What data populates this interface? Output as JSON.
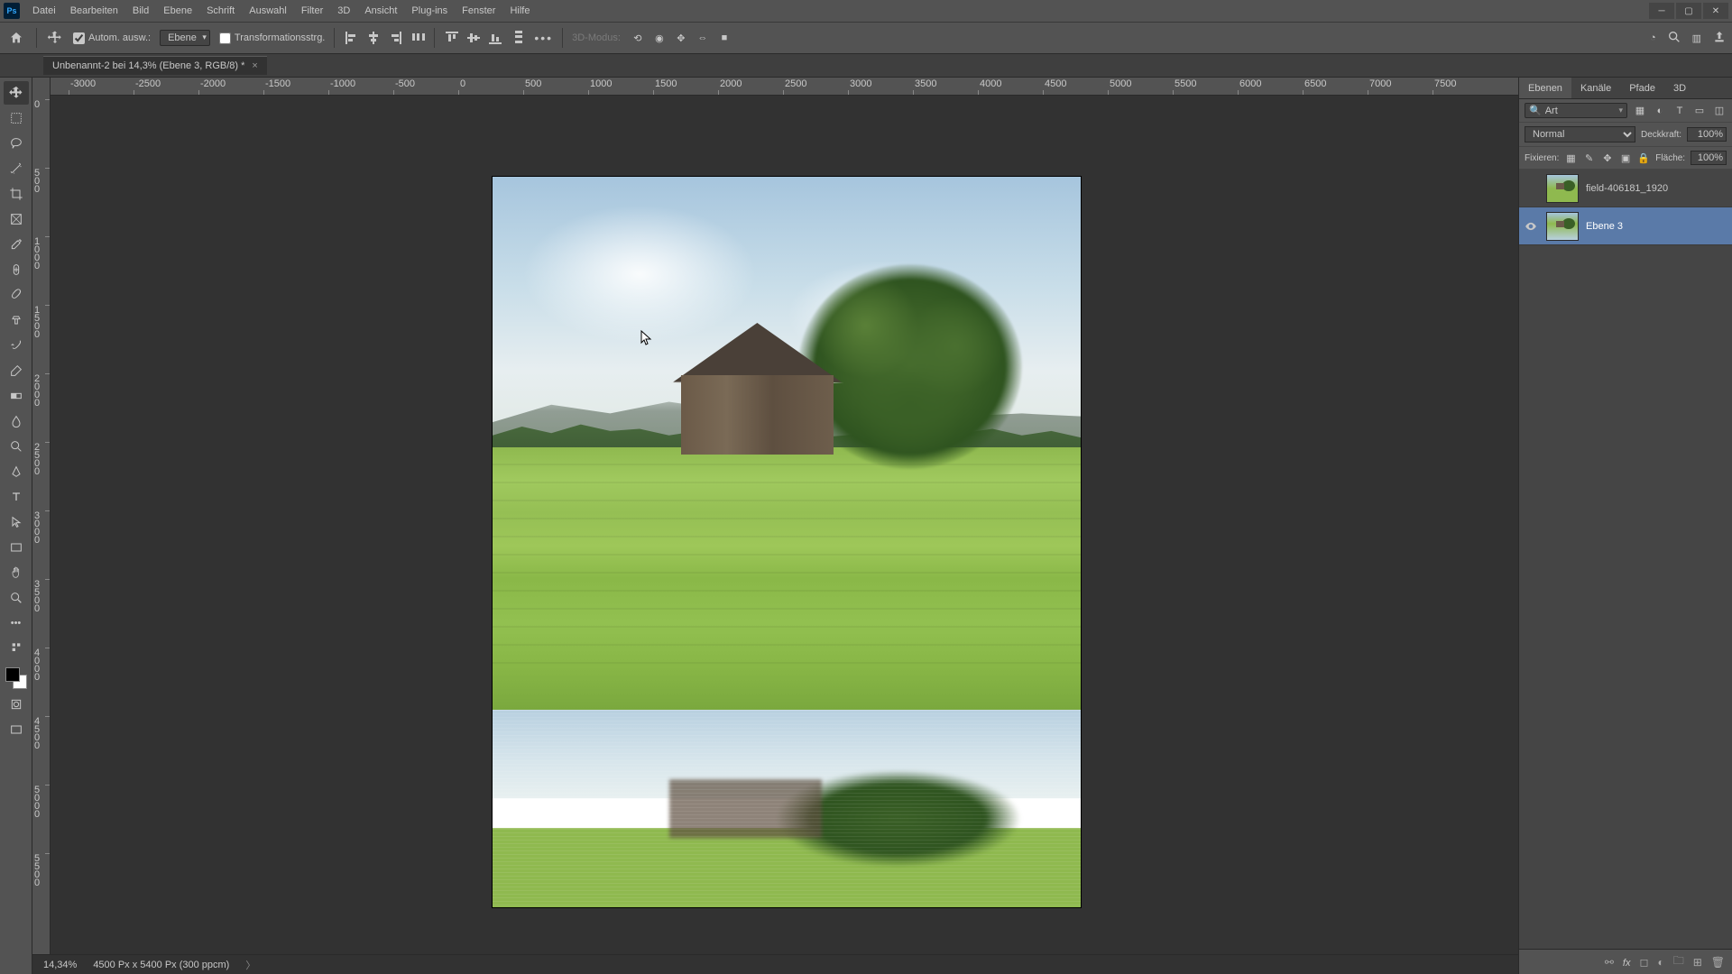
{
  "menubar": {
    "logo": "Ps",
    "items": [
      "Datei",
      "Bearbeiten",
      "Bild",
      "Ebene",
      "Schrift",
      "Auswahl",
      "Filter",
      "3D",
      "Ansicht",
      "Plug-ins",
      "Fenster",
      "Hilfe"
    ]
  },
  "optionsbar": {
    "auto_select_label": "Autom. ausw.:",
    "auto_select_target": "Ebene",
    "transform_controls_label": "Transformationsstrg.",
    "mode_3d_label": "3D-Modus:"
  },
  "document": {
    "tab_title": "Unbenannt-2 bei 14,3% (Ebene 3, RGB/8) *"
  },
  "ruler_h": [
    "-3000",
    "-2500",
    "-2000",
    "-1500",
    "-1000",
    "-500",
    "0",
    "500",
    "1000",
    "1500",
    "2000",
    "2500",
    "3000",
    "3500",
    "4000",
    "4500",
    "5000",
    "5500",
    "6000",
    "6500",
    "7000",
    "7500"
  ],
  "ruler_v": [
    "0",
    "500",
    "1000",
    "1500",
    "2000",
    "2500",
    "3000",
    "3500",
    "4000",
    "4500",
    "5000",
    "5500"
  ],
  "statusbar": {
    "zoom": "14,34%",
    "doc_info": "4500 Px x 5400 Px (300 ppcm)"
  },
  "panels": {
    "tabs": [
      "Ebenen",
      "Kanäle",
      "Pfade",
      "3D"
    ],
    "search_value": "Art",
    "blend_mode": "Normal",
    "opacity_label": "Deckkraft:",
    "opacity_value": "100%",
    "lock_label": "Fixieren:",
    "fill_label": "Fläche:",
    "fill_value": "100%",
    "layers": [
      {
        "name": "field-406181_1920",
        "visible": false
      },
      {
        "name": "Ebene 3",
        "visible": true,
        "selected": true
      }
    ]
  }
}
